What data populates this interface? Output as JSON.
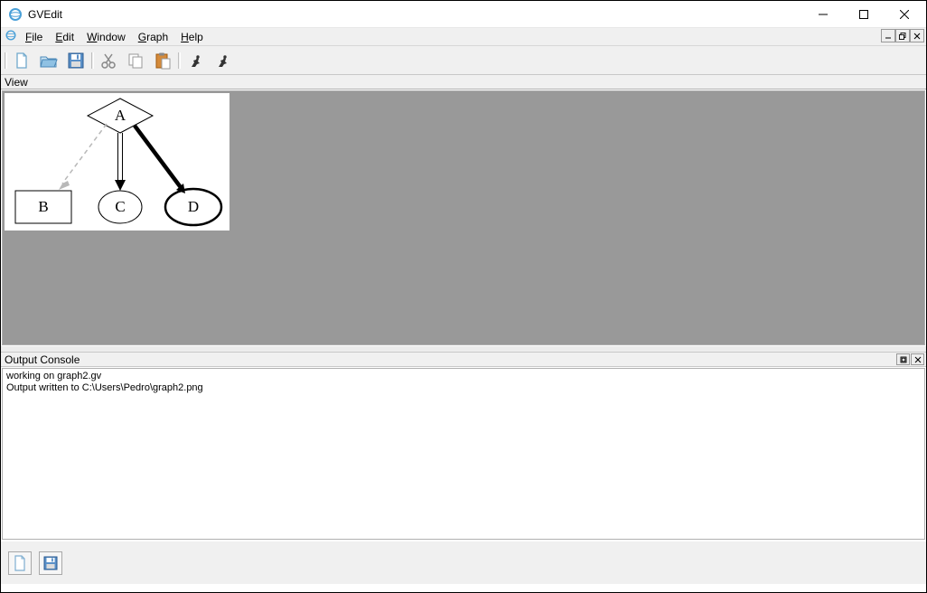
{
  "window": {
    "title": "GVEdit"
  },
  "menus": {
    "file": "File",
    "edit": "Edit",
    "window": "Window",
    "graph": "Graph",
    "help": "Help"
  },
  "view_panel": {
    "label": "View"
  },
  "output_console": {
    "label": "Output Console",
    "lines": [
      "working on graph2.gv",
      "Output written to C:\\Users\\Pedro\\graph2.png"
    ]
  },
  "graph": {
    "nodes": {
      "A": "A",
      "B": "B",
      "C": "C",
      "D": "D"
    }
  },
  "toolbar_icons": [
    "new-file-icon",
    "open-folder-icon",
    "save-icon",
    "cut-icon",
    "copy-icon",
    "paste-icon",
    "run-layout-icon",
    "run-icon"
  ]
}
